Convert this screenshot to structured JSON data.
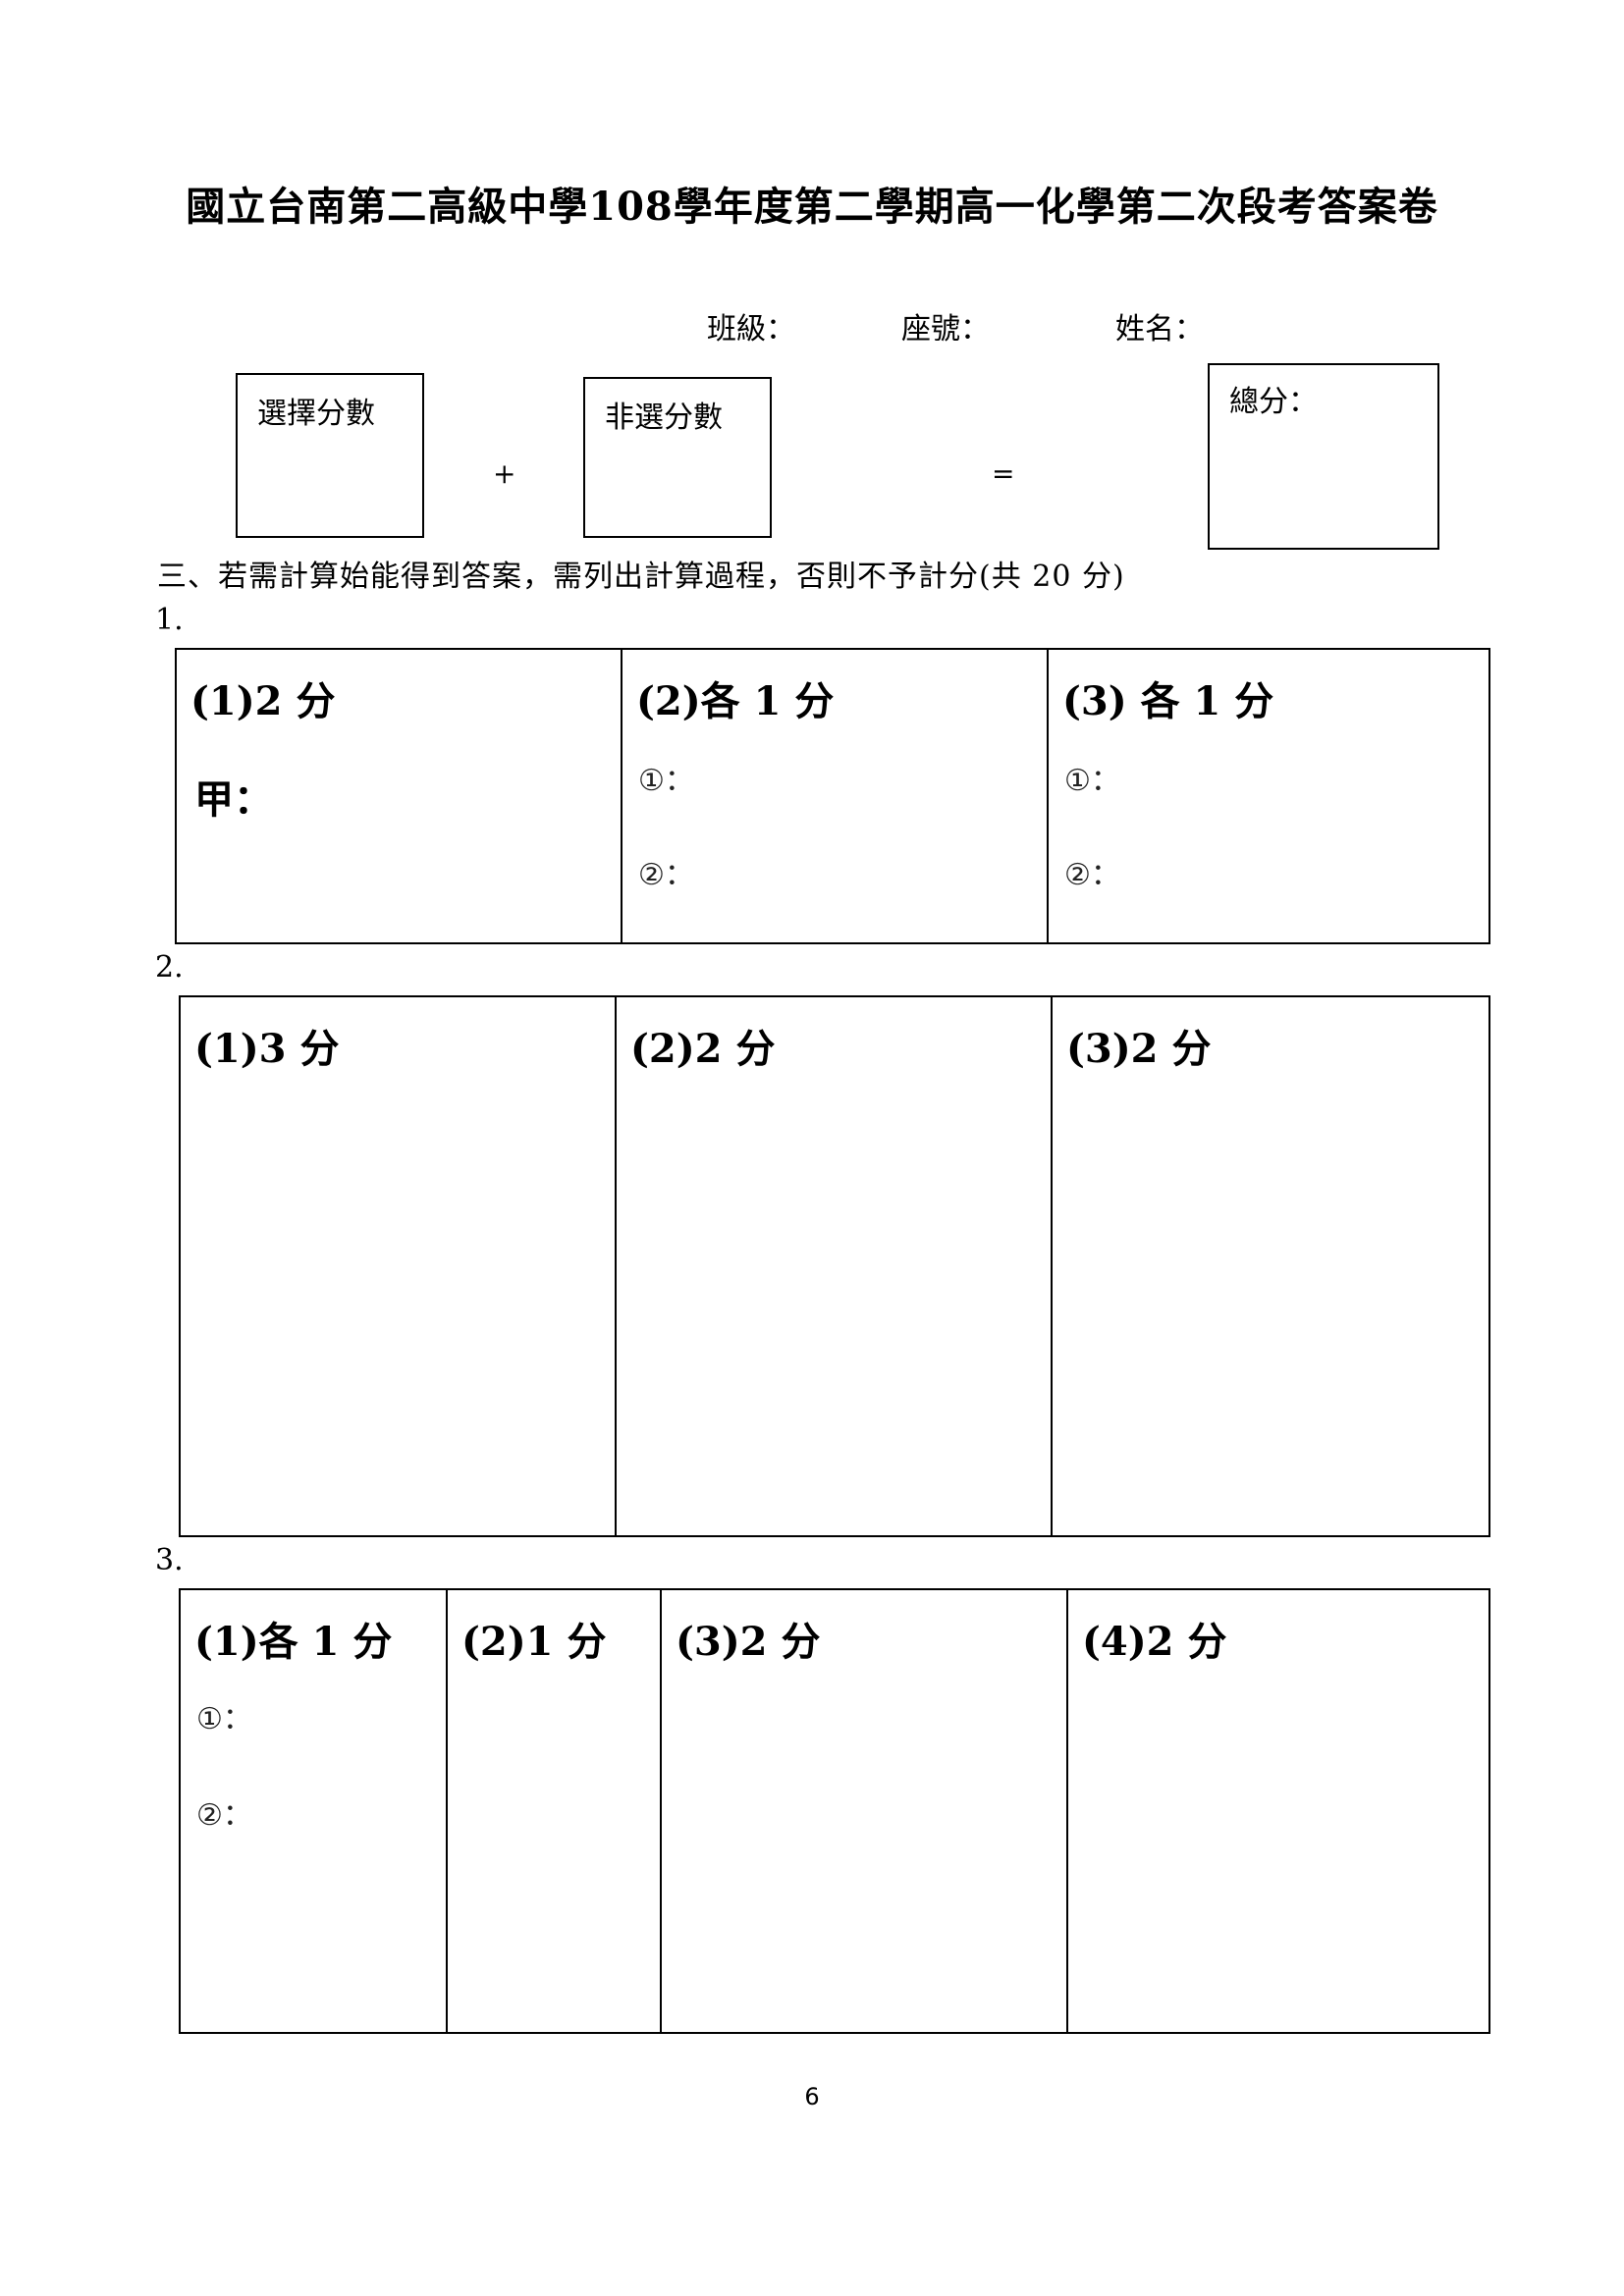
{
  "header": {
    "title": "國立台南第二高級中學108學年度第二學期高一化學第二次段考答案卷",
    "class_label": "班級：",
    "seat_label": "座號：",
    "name_label": "姓名："
  },
  "score": {
    "choice_label": "選擇分數",
    "plus": "+",
    "nonchoice_label": "非選分數",
    "equals": "=",
    "total_label": "總分："
  },
  "section3": {
    "instruction": "三、若需計算始能得到答案，需列出計算過程，否則不予計分(共 20 分)"
  },
  "q1": {
    "number": "1.",
    "c1_title": "(1)2 分",
    "c1_jia": "甲：",
    "c2_title": "(2)各 1 分",
    "c2_s1": "①：",
    "c2_s2": "②：",
    "c3_title": "(3) 各 1 分",
    "c3_s1": "①：",
    "c3_s2": "②："
  },
  "q2": {
    "number": "2.",
    "c1_title": "(1)3 分",
    "c2_title": "(2)2 分",
    "c3_title": "(3)2 分"
  },
  "q3": {
    "number": "3.",
    "c1_title": "(1)各 1 分",
    "c1_s1": "①：",
    "c1_s2": "②：",
    "c2_title": "(2)1 分",
    "c3_title": "(3)2 分",
    "c4_title": "(4)2 分"
  },
  "footer": {
    "page_number": "6"
  }
}
